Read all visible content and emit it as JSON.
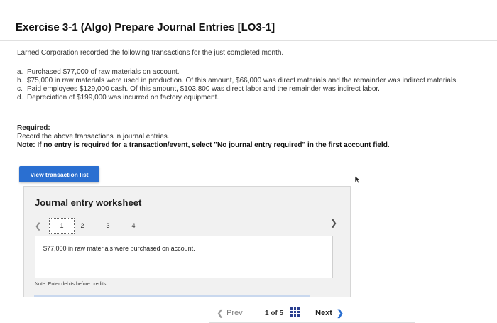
{
  "title": "Exercise 3-1 (Algo) Prepare Journal Entries [LO3-1]",
  "intro": "Larned Corporation recorded the following transactions for the just completed month.",
  "transactions": [
    {
      "letter": "a.",
      "text": "Purchased $77,000 of raw materials on account."
    },
    {
      "letter": "b.",
      "text": "$75,000 in raw materials were used in production. Of this amount, $66,000 was direct materials and the remainder was indirect materials."
    },
    {
      "letter": "c.",
      "text": "Paid employees $129,000 cash. Of this amount, $103,800 was direct labor and the remainder was indirect labor."
    },
    {
      "letter": "d.",
      "text": "Depreciation of $199,000 was incurred on factory equipment."
    }
  ],
  "required": {
    "heading": "Required:",
    "instruction": "Record the above transactions in journal entries.",
    "note": "Note: If no entry is required for a transaction/event, select \"No journal entry required\" in the first account field."
  },
  "view_button": "View transaction list",
  "worksheet": {
    "title": "Journal entry worksheet",
    "pages": [
      "1",
      "2",
      "3",
      "4"
    ],
    "active_page": "1",
    "description": "$77,000 in raw materials were purchased on account.",
    "note": "Note: Enter debits before credits."
  },
  "nav": {
    "prev": "Prev",
    "page_count": "1 of 5",
    "next": "Next"
  },
  "colors": {
    "accent": "#2a6fd1",
    "panel_bg": "#f1f1f1"
  }
}
